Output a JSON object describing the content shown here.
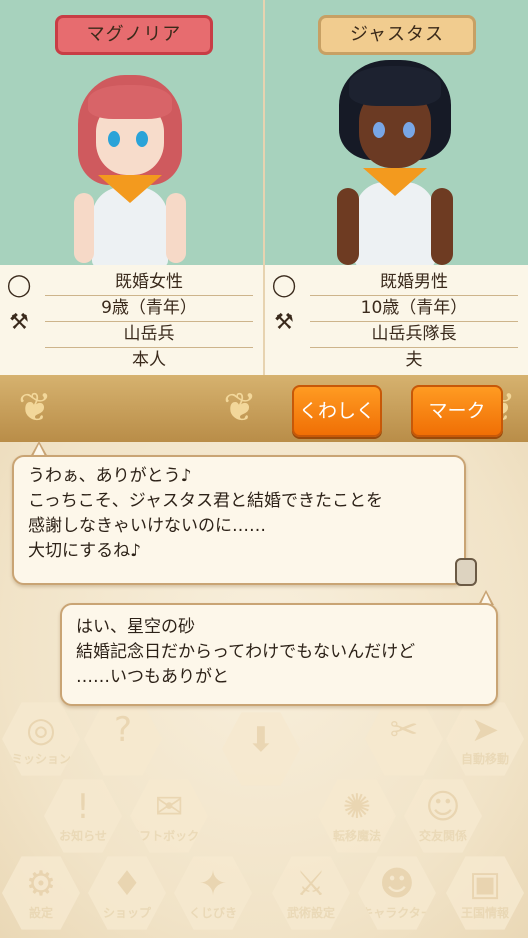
{
  "couple": {
    "left": {
      "name": "マグノリア",
      "rows": [
        "既婚女性",
        "9歳（青年）",
        "山岳兵",
        "本人"
      ]
    },
    "right": {
      "name": "ジャスタス",
      "rows": [
        "既婚男性",
        "10歳（青年）",
        "山岳兵隊長",
        "夫"
      ]
    }
  },
  "actions": {
    "detail_label": "くわしく",
    "mark_label": "マーク"
  },
  "dialog": {
    "first": [
      "うわぁ、ありがとう♪",
      "こっちこそ、ジャスタス君と結婚できたことを",
      "感謝しなきゃいけないのに……",
      "大切にするね♪"
    ],
    "second": [
      "はい、星空の砂",
      "結婚記念日だからってわけでもないんだけど",
      "……いつもありがと"
    ]
  },
  "menu": [
    {
      "label": "ミッション",
      "icon": "mission-icon"
    },
    {
      "label": "",
      "icon": "help-icon"
    },
    {
      "label": "",
      "icon": "arrow-down-icon"
    },
    {
      "label": "",
      "icon": "craft-icon"
    },
    {
      "label": "自動移動",
      "icon": "auto-move-icon"
    },
    {
      "label": "お知らせ",
      "icon": "notice-icon"
    },
    {
      "label": "ギフトボックス",
      "icon": "gift-box-icon"
    },
    {
      "label": "転移魔法",
      "icon": "teleport-icon"
    },
    {
      "label": "交友関係",
      "icon": "friends-icon"
    },
    {
      "label": "設定",
      "icon": "settings-icon"
    },
    {
      "label": "ショップ",
      "icon": "shop-icon"
    },
    {
      "label": "くじびき",
      "icon": "lottery-icon"
    },
    {
      "label": "武術設定",
      "icon": "martial-icon"
    },
    {
      "label": "キャラクター",
      "icon": "character-icon"
    },
    {
      "label": "王国情報",
      "icon": "kingdom-info-icon"
    }
  ],
  "colors": {
    "accent_orange": "#f27a0c",
    "portrait_bg": "#a7d2bd",
    "female_tag": "#e76c6f",
    "male_tag": "#f1cc8f"
  }
}
